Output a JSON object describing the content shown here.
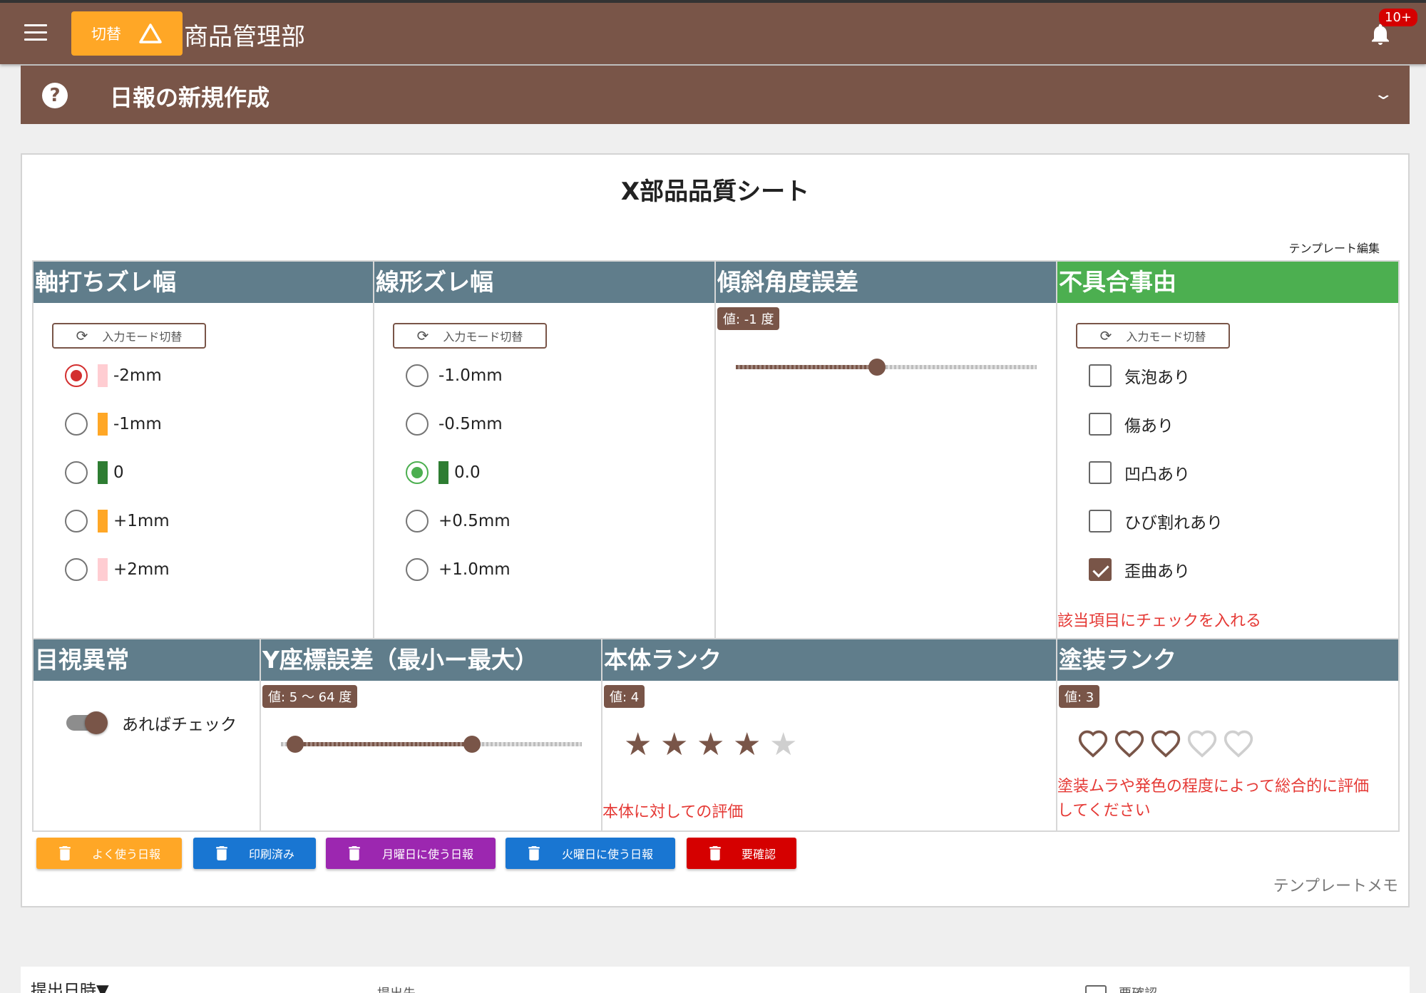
{
  "header": {
    "switch_label": "切替",
    "switch_icon": "warning-triangle-icon",
    "app_title": "商品管理部",
    "notification_badge": "10+"
  },
  "section": {
    "title": "日報の新規作成"
  },
  "sheet": {
    "title": "X部品品質シート",
    "template_edit": "テンプレート編集",
    "template_memo": "テンプレートメモ"
  },
  "fields": {
    "shaft": {
      "title": "軸打ちズレ幅",
      "mode_label": "入力モード切替",
      "options": [
        {
          "label": "-2mm",
          "color": "#ffcdd2",
          "selected": true
        },
        {
          "label": "-1mm",
          "color": "#ffa726",
          "selected": false
        },
        {
          "label": "0",
          "color": "#2e7d32",
          "selected": false
        },
        {
          "label": "+1mm",
          "color": "#ffa726",
          "selected": false
        },
        {
          "label": "+2mm",
          "color": "#ffcdd2",
          "selected": false
        }
      ]
    },
    "linear": {
      "title": "線形ズレ幅",
      "mode_label": "入力モード切替",
      "options": [
        {
          "label": "-1.0mm",
          "selected": false
        },
        {
          "label": "-0.5mm",
          "selected": false
        },
        {
          "label": "0.0",
          "color": "#2e7d32",
          "selected": true
        },
        {
          "label": "+0.5mm",
          "selected": false
        },
        {
          "label": "+1.0mm",
          "selected": false
        }
      ]
    },
    "tilt": {
      "title": "傾斜角度誤差",
      "value_label": "値: -1 度",
      "value": -1,
      "fraction": 0.47
    },
    "defect": {
      "title": "不具合事由",
      "mode_label": "入力モード切替",
      "options": [
        {
          "label": "気泡あり",
          "checked": false
        },
        {
          "label": "傷あり",
          "checked": false
        },
        {
          "label": "凹凸あり",
          "checked": false
        },
        {
          "label": "ひび割れあり",
          "checked": false
        },
        {
          "label": "歪曲あり",
          "checked": true
        }
      ],
      "hint": "該当項目にチェックを入れる"
    },
    "visual": {
      "title": "目視異常",
      "toggle_label": "あればチェック",
      "on": true
    },
    "ycoord": {
      "title": "Y座標誤差（最小ー最大）",
      "value_label": "値: 5 〜 64 度",
      "min": 5,
      "max": 64
    },
    "body_rank": {
      "title": "本体ランク",
      "value_label": "値: 4",
      "value": 4,
      "max": 5,
      "hint": "本体に対しての評価"
    },
    "paint_rank": {
      "title": "塗装ランク",
      "value_label": "値: 3",
      "value": 3,
      "max": 5,
      "hint_line1": "塗装ムラや発色の程度によって総合的に評価",
      "hint_line2": "してください"
    }
  },
  "tags": [
    {
      "label": "よく使う日報",
      "color": "#ffa726"
    },
    {
      "label": "印刷済み",
      "color": "#1976d2"
    },
    {
      "label": "月曜日に使う日報",
      "color": "#9c27b0"
    },
    {
      "label": "火曜日に使う日報",
      "color": "#1976d2"
    },
    {
      "label": "要確認",
      "color": "#d50000"
    }
  ],
  "list": {
    "sort_label": "提出日時▼",
    "col2": "提出先",
    "col3": "要確認"
  },
  "colors": {
    "brand": "#795548",
    "header_cell": "#607d8b",
    "header_cell_alert": "#4caf50",
    "hint": "#e53935"
  }
}
